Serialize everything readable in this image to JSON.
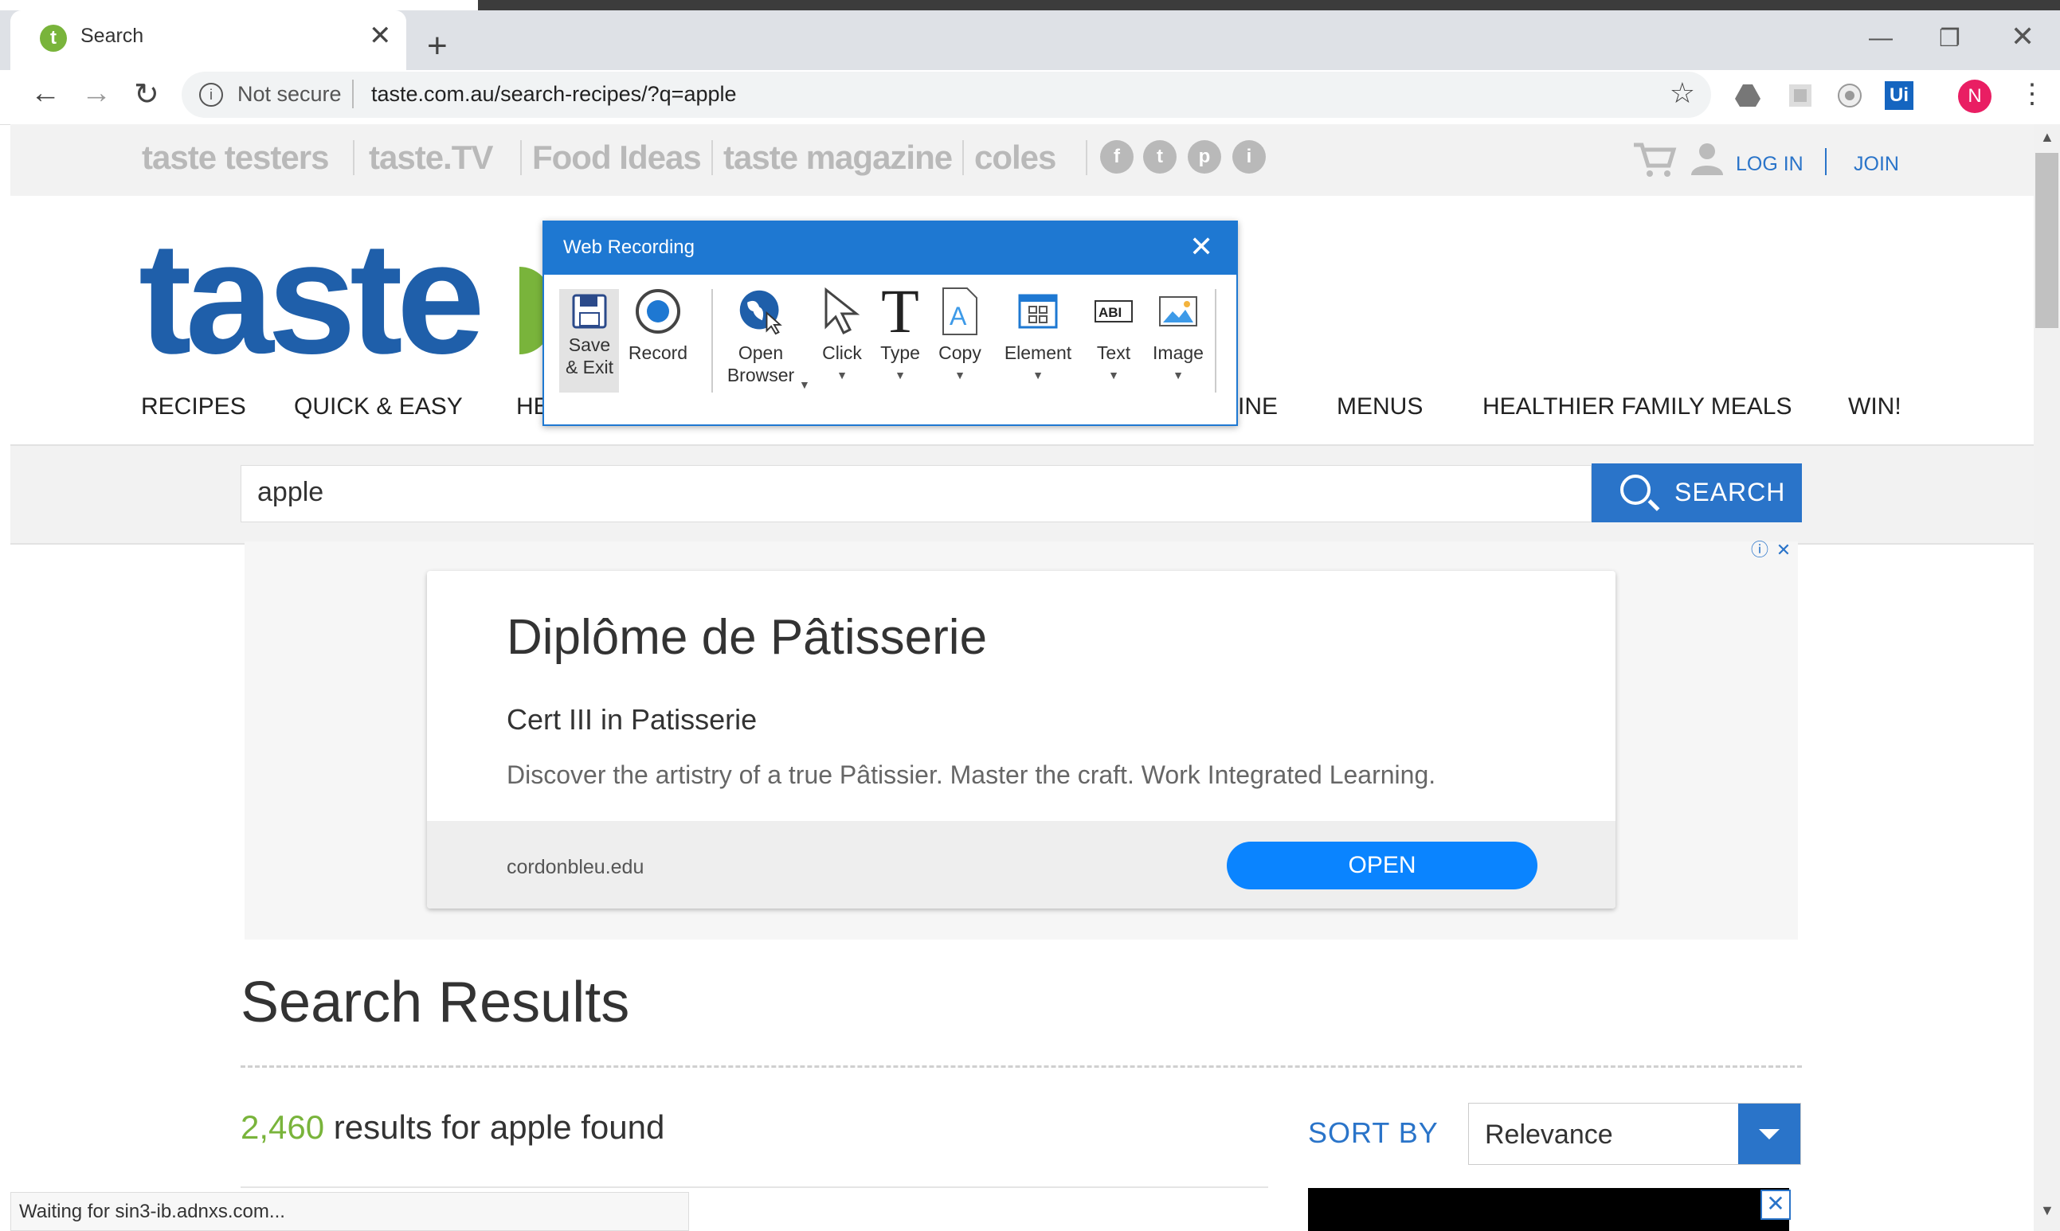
{
  "browser": {
    "tab_title": "Search",
    "tab_favicon_letter": "t",
    "tab_close": "✕",
    "new_tab": "+",
    "security_label": "Not secure",
    "url": "taste.com.au/search-recipes/?q=apple",
    "profile_initial": "N",
    "extensions": [
      "drive-icon",
      "puzzle-icon",
      "camera-icon",
      "uipath-icon"
    ],
    "uipath_label": "Ui",
    "status_text": "Waiting for sin3-ib.adnxs.com..."
  },
  "site": {
    "brand_links": [
      "taste testers",
      "taste.TV",
      "Food Ideas",
      "taste magazine",
      "coles"
    ],
    "social": [
      "f",
      "t",
      "p",
      "i"
    ],
    "login": "LOG IN",
    "join": "JOIN",
    "logo": "taste",
    "nav": [
      "RECIPES",
      "QUICK & EASY",
      "HE",
      "INE",
      "MENUS",
      "HEALTHIER FAMILY MEALS",
      "WIN!"
    ],
    "search_value": "apple",
    "search_button": "SEARCH"
  },
  "ad": {
    "headline": "Diplôme de Pâtisserie",
    "subhead": "Cert III in Patisserie",
    "description": "Discover the artistry of a true Pâtissier. Master the craft. Work Integrated Learning.",
    "domain": "cordonbleu.edu",
    "cta": "OPEN"
  },
  "results": {
    "heading": "Search Results",
    "count": "2,460",
    "count_suffix": " results for apple found",
    "sort_label": "SORT BY",
    "sort_value": "Relevance"
  },
  "recorder": {
    "title": "Web Recording",
    "tools": [
      {
        "label": "Save\n& Exit",
        "icon": "floppy-disk-icon"
      },
      {
        "label": "Record",
        "icon": "record-icon"
      },
      {
        "label": "Open\nBrowser",
        "icon": "globe-icon"
      },
      {
        "label": "Click",
        "icon": "cursor-icon"
      },
      {
        "label": "Type",
        "icon": "type-icon"
      },
      {
        "label": "Copy",
        "icon": "copy-icon"
      },
      {
        "label": "Element",
        "icon": "element-icon"
      },
      {
        "label": "Text",
        "icon": "text-icon"
      },
      {
        "label": "Image",
        "icon": "image-icon"
      }
    ]
  },
  "colors": {
    "brand_blue": "#1f5faa",
    "link_blue": "#2a74c9",
    "green": "#79b43b",
    "recorder_blue": "#1e78d2"
  }
}
